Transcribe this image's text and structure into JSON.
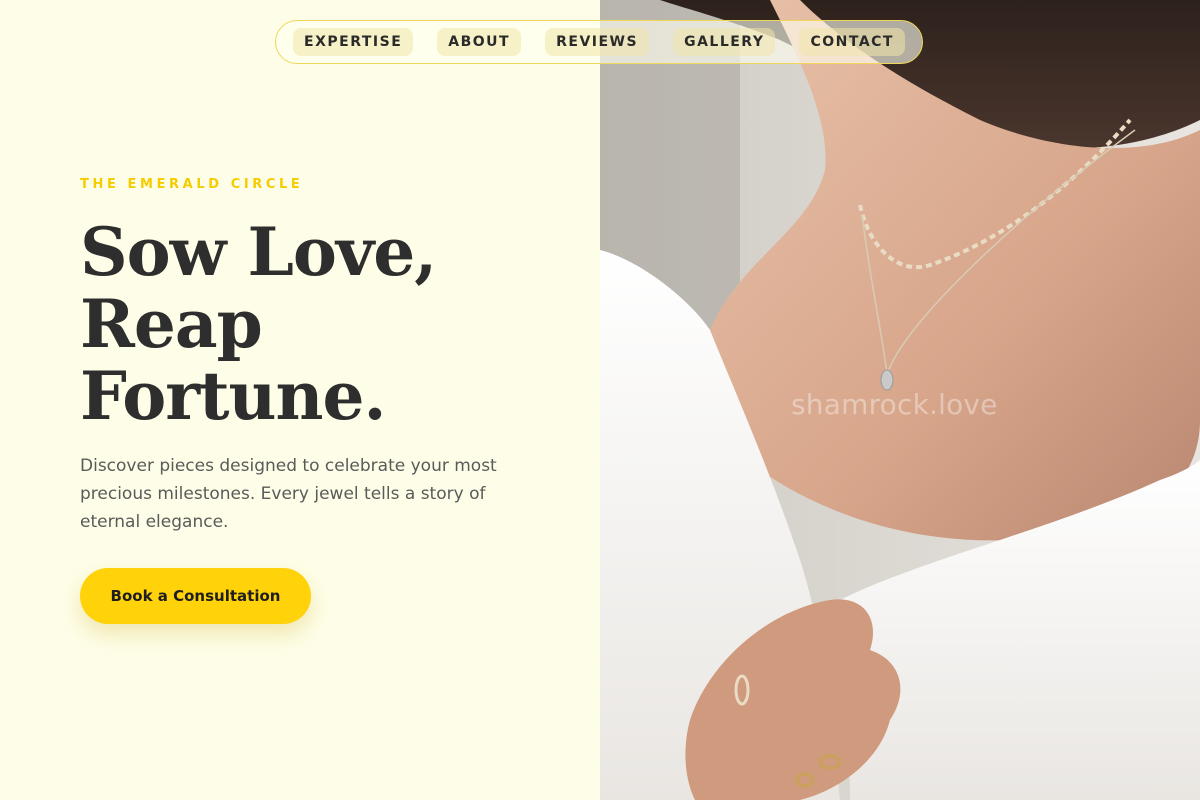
{
  "nav": {
    "items": [
      {
        "label": "EXPERTISE"
      },
      {
        "label": "ABOUT"
      },
      {
        "label": "REVIEWS"
      },
      {
        "label": "GALLERY"
      },
      {
        "label": "CONTACT"
      }
    ]
  },
  "hero": {
    "eyebrow": "THE EMERALD CIRCLE",
    "headline_lines": [
      "Sow Love,",
      "Reap",
      "Fortune."
    ],
    "body": "Discover pieces designed to celebrate your most precious milestones. Every jewel tells a story of eternal elegance.",
    "cta_label": "Book a Consultation"
  },
  "photo": {
    "watermark": "shamrock.love"
  },
  "colors": {
    "background": "#fefee8",
    "accent": "#ffd20a",
    "eyebrow": "#f5cc00",
    "heading": "#2e2e2e",
    "body": "#5a5a5a"
  }
}
